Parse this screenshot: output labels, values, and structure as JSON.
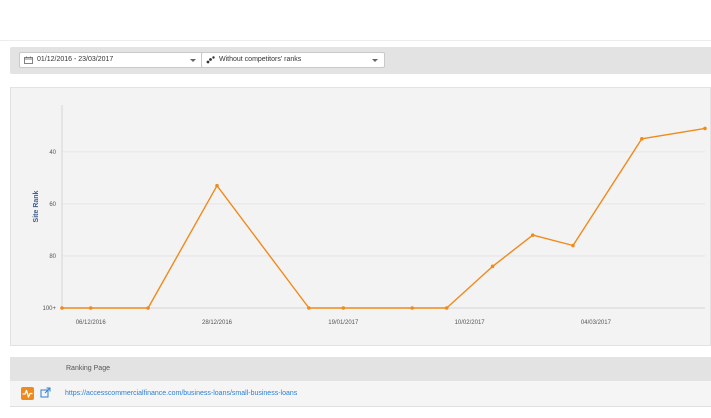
{
  "toolbar": {
    "date_range": "01/12/2016 - 23/03/2017",
    "date_icon": "calendar-icon",
    "competitors_mode": "Without competitors' ranks",
    "competitors_icon": "scatter-icon"
  },
  "chart_data": {
    "type": "line",
    "ylabel": "Site Rank",
    "y_inverted": true,
    "ylim": [
      22,
      100
    ],
    "yticks": [
      "40",
      "60",
      "80",
      "100+"
    ],
    "x_tick_labels": [
      "06/12/2016",
      "28/12/2016",
      "19/01/2017",
      "10/02/2017",
      "04/03/2017"
    ],
    "x": [
      "2016-12-01",
      "2016-12-06",
      "2016-12-16",
      "2016-12-28",
      "2017-01-13",
      "2017-01-19",
      "2017-01-31",
      "2017-02-06",
      "2017-02-14",
      "2017-02-21",
      "2017-02-28",
      "2017-03-12",
      "2017-03-23"
    ],
    "series": [
      {
        "values": [
          100,
          100,
          100,
          53,
          100,
          100,
          100,
          100,
          84,
          72,
          76,
          35,
          31
        ],
        "color": "#f08a1c"
      }
    ],
    "grid": true,
    "line_color": "#f08a1c",
    "grid_color": "#e0e0e0"
  },
  "table": {
    "header": "Ranking Page",
    "rows": [
      {
        "url": "https://accesscommercialfinance.com/business-loans/small-business-loans",
        "badge_icon": "pulse-icon",
        "link_icon": "external-link-icon"
      }
    ]
  }
}
